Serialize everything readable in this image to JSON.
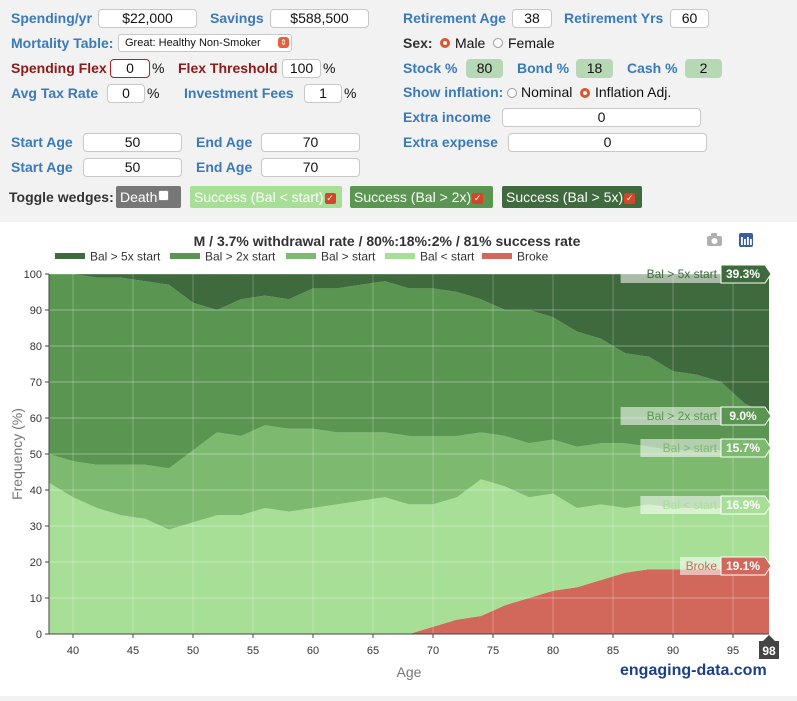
{
  "controls": {
    "spending_label": "Spending/yr",
    "spending_value": "$22,000",
    "savings_label": "Savings",
    "savings_value": "$588,500",
    "retirement_age_label": "Retirement Age",
    "retirement_age_value": "38",
    "retirement_yrs_label": "Retirement Yrs",
    "retirement_yrs_value": "60",
    "mortality_label": "Mortality Table:",
    "mortality_value": "Great: Healthy Non-Smoker",
    "sex_label": "Sex:",
    "sex_male": "Male",
    "sex_female": "Female",
    "spending_flex_label": "Spending Flex",
    "spending_flex_value": "0",
    "flex_threshold_label": "Flex Threshold",
    "flex_threshold_value": "100",
    "stock_label": "Stock %",
    "stock_value": "80",
    "bond_label": "Bond %",
    "bond_value": "18",
    "cash_label": "Cash %",
    "cash_value": "2",
    "tax_label": "Avg Tax Rate",
    "tax_value": "0",
    "fees_label": "Investment Fees",
    "fees_value": "1",
    "percent_sign": "%",
    "inflation_label": "Show inflation:",
    "inflation_nominal": "Nominal",
    "inflation_adj": "Inflation Adj.",
    "extra_income_label": "Extra income",
    "extra_income_value": "0",
    "extra_expense_label": "Extra expense",
    "extra_expense_value": "0",
    "start_age_label": "Start Age",
    "end_age_label": "End Age",
    "start_age_1": "50",
    "end_age_1": "70",
    "start_age_2": "50",
    "end_age_2": "70",
    "toggle_label": "Toggle wedges:",
    "wedge_death": "Death",
    "wedge_success_start": "Success (Bal < start)",
    "wedge_success_2x": "Success (Bal > 2x)",
    "wedge_success_5x": "Success (Bal > 5x)"
  },
  "brand": "engaging-data.com",
  "colors": {
    "c5x": "#3f6a3d",
    "c2x": "#5a9651",
    "cstart": "#7db96f",
    "cbelow": "#a8df97",
    "broke": "#d2685c"
  },
  "chart_data": {
    "type": "area",
    "stacked": true,
    "title": "M / 3.7% withdrawal rate / 80%:18%:2% / 81% success rate",
    "xlabel": "Age",
    "ylabel": "Frequency (%)",
    "xlim": [
      38,
      98
    ],
    "ylim": [
      0,
      100
    ],
    "xticks": [
      40,
      45,
      50,
      55,
      60,
      65,
      70,
      75,
      80,
      85,
      90,
      95
    ],
    "yticks": [
      0,
      10,
      20,
      30,
      40,
      50,
      60,
      70,
      80,
      90,
      100
    ],
    "x_end_badge": "98",
    "legend_position": "top",
    "x": [
      38,
      40,
      42,
      44,
      46,
      48,
      50,
      52,
      54,
      56,
      58,
      60,
      62,
      64,
      66,
      68,
      70,
      72,
      74,
      76,
      78,
      80,
      82,
      84,
      86,
      88,
      90,
      92,
      94,
      96,
      98
    ],
    "series": [
      {
        "name": "Broke",
        "color_key": "broke",
        "values": [
          0,
          0,
          0,
          0,
          0,
          0,
          0,
          0,
          0,
          0,
          0,
          0,
          0,
          0,
          0,
          0,
          2,
          4,
          5,
          8,
          10,
          12,
          13,
          15,
          17,
          18,
          18,
          18,
          18,
          19,
          19.1
        ]
      },
      {
        "name": "Bal < start",
        "color_key": "cbelow",
        "values": [
          42,
          38,
          35,
          33,
          32,
          29,
          31,
          33,
          33,
          35,
          34,
          35,
          36,
          37,
          38,
          36,
          34,
          34,
          38,
          33,
          28,
          27,
          22,
          21,
          18,
          18,
          17,
          17,
          17,
          17,
          16.9
        ]
      },
      {
        "name": "Bal > start",
        "color_key": "cstart",
        "values": [
          8,
          10,
          12,
          14,
          15,
          17,
          20,
          23,
          22,
          23,
          23,
          22,
          20,
          19,
          18,
          19,
          19,
          17,
          13,
          14,
          15,
          15,
          17,
          17,
          18,
          16,
          16,
          16,
          16,
          16,
          15.7
        ]
      },
      {
        "name": "Bal > 2x start",
        "color_key": "c2x",
        "values": [
          50,
          52,
          52,
          52,
          51,
          51,
          41,
          34,
          38,
          36,
          36,
          39,
          40,
          41,
          42,
          41,
          41,
          40,
          37,
          35,
          37,
          34,
          32,
          29,
          25,
          25,
          22,
          21,
          19,
          12,
          9.0
        ]
      },
      {
        "name": "Bal > 5x start",
        "color_key": "c5x",
        "values": [
          0,
          0,
          1,
          1,
          2,
          3,
          8,
          10,
          7,
          6,
          7,
          4,
          4,
          3,
          2,
          4,
          4,
          5,
          7,
          10,
          10,
          12,
          16,
          18,
          22,
          23,
          27,
          28,
          30,
          36,
          39.3
        ]
      }
    ],
    "end_labels": [
      {
        "name": "Bal > 5x start",
        "value": "39.3%",
        "color_key": "c5x"
      },
      {
        "name": "Bal > 2x start",
        "value": "9.0%",
        "color_key": "c2x"
      },
      {
        "name": "Bal > start",
        "value": "15.7%",
        "color_key": "cstart"
      },
      {
        "name": "Bal < start",
        "value": "16.9%",
        "color_key": "cbelow"
      },
      {
        "name": "Broke",
        "value": "19.1%",
        "color_key": "broke"
      }
    ],
    "legend": [
      "Bal > 5x start",
      "Bal > 2x start",
      "Bal > start",
      "Bal < start",
      "Broke"
    ]
  }
}
